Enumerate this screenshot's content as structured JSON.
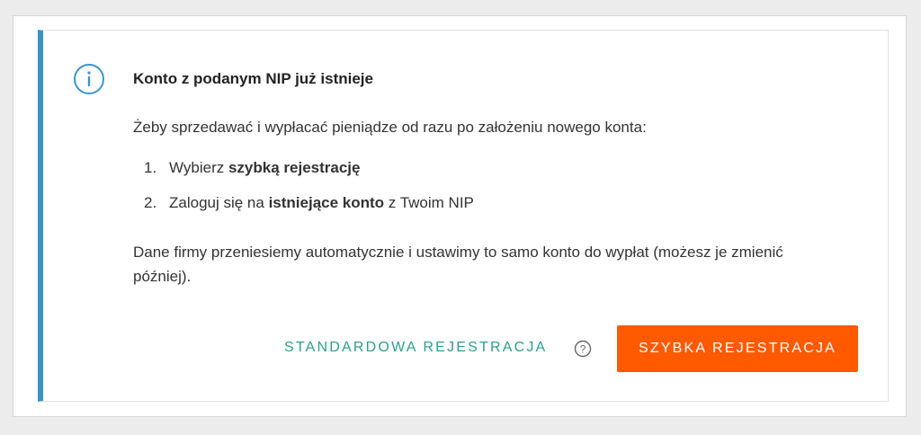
{
  "alert": {
    "title": "Konto z podanym NIP już istnieje",
    "intro": "Żeby sprzedawać i wypłacać pieniądze od razu po założeniu nowego konta:",
    "steps": [
      {
        "num": "1.",
        "before": "Wybierz ",
        "bold": "szybką rejestrację",
        "after": ""
      },
      {
        "num": "2.",
        "before": "Zaloguj się na ",
        "bold": "istniejące konto",
        "after": " z Twoim NIP"
      }
    ],
    "note": "Dane firmy przeniesiemy automatycznie i ustawimy to samo konto do wypłat (możesz je zmienić później).",
    "accent_color": "#3a97c5"
  },
  "actions": {
    "standard_label": "STANDARDOWA REJESTRACJA",
    "standard_color": "#2a9f8f",
    "help_icon": "question-circle-icon",
    "fast_label": "SZYBKA REJESTRACJA",
    "fast_color": "#ff5a00"
  }
}
